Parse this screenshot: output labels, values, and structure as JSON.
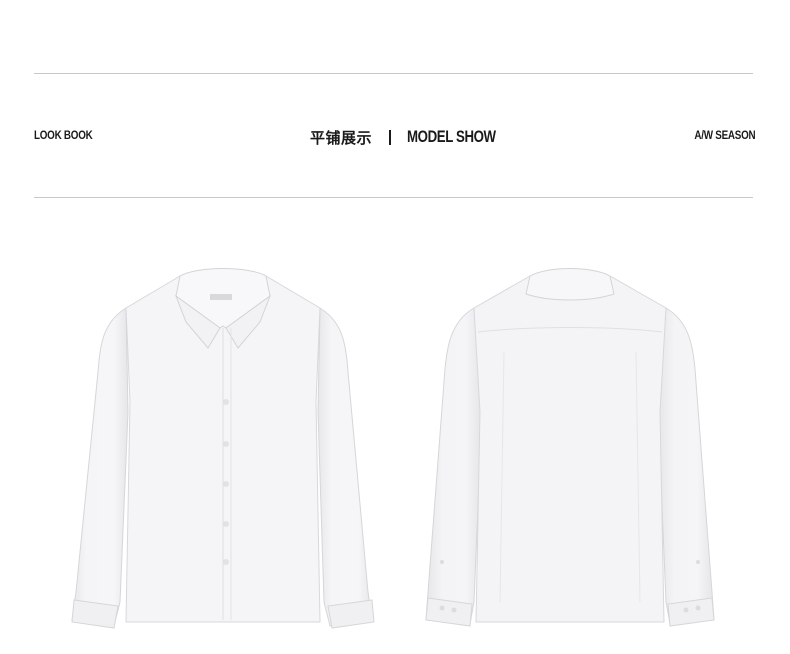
{
  "header": {
    "left_label": "LOOK BOOK",
    "center_title_cn": "平铺展示",
    "center_title_en": "MODEL SHOW",
    "right_label": "A/W SEASON"
  },
  "images": {
    "front_shirt": "white-shirt-front",
    "back_shirt": "white-shirt-back"
  },
  "colors": {
    "rule": "#c8c8c8",
    "text": "#1a1a1a",
    "shirt": "#f4f4f5"
  }
}
